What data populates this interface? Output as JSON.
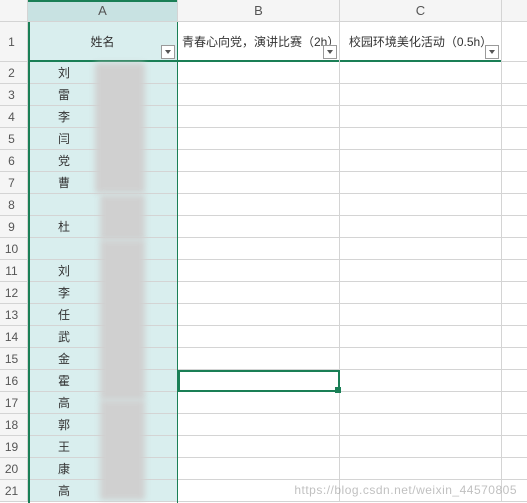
{
  "columns": {
    "a": "A",
    "b": "B",
    "c": "C"
  },
  "header_row": {
    "a": "姓名",
    "b": "青春心向党，演讲比赛（2h）",
    "c": "校园环境美化活动（0.5h）"
  },
  "rows": [
    {
      "num": "1"
    },
    {
      "num": "2",
      "a": "刘"
    },
    {
      "num": "3",
      "a": "雷"
    },
    {
      "num": "4",
      "a": "李"
    },
    {
      "num": "5",
      "a": "闫"
    },
    {
      "num": "6",
      "a": "党"
    },
    {
      "num": "7",
      "a": "曹"
    },
    {
      "num": "8",
      "a": ""
    },
    {
      "num": "9",
      "a": "杜"
    },
    {
      "num": "10",
      "a": ""
    },
    {
      "num": "11",
      "a": "刘"
    },
    {
      "num": "12",
      "a": "李"
    },
    {
      "num": "13",
      "a": "任"
    },
    {
      "num": "14",
      "a": "武"
    },
    {
      "num": "15",
      "a": "金"
    },
    {
      "num": "16",
      "a": "霍"
    },
    {
      "num": "17",
      "a": "高"
    },
    {
      "num": "18",
      "a": "郭"
    },
    {
      "num": "19",
      "a": "王"
    },
    {
      "num": "20",
      "a": "康"
    },
    {
      "num": "21",
      "a": "高"
    }
  ],
  "active_cell": "B16",
  "watermark": "https://blog.csdn.net/weixin_44570805",
  "chart_data": {
    "type": "table",
    "columns": [
      "姓名",
      "青春心向党，演讲比赛（2h）",
      "校园环境美化活动（0.5h）"
    ],
    "visible_name_prefixes": [
      "刘",
      "雷",
      "李",
      "闫",
      "党",
      "曹",
      "",
      "杜",
      "",
      "刘",
      "李",
      "任",
      "武",
      "金",
      "霍",
      "高",
      "郭",
      "王",
      "康",
      "高"
    ],
    "note": "Full names redacted/blurred in source image; only first characters visible."
  }
}
